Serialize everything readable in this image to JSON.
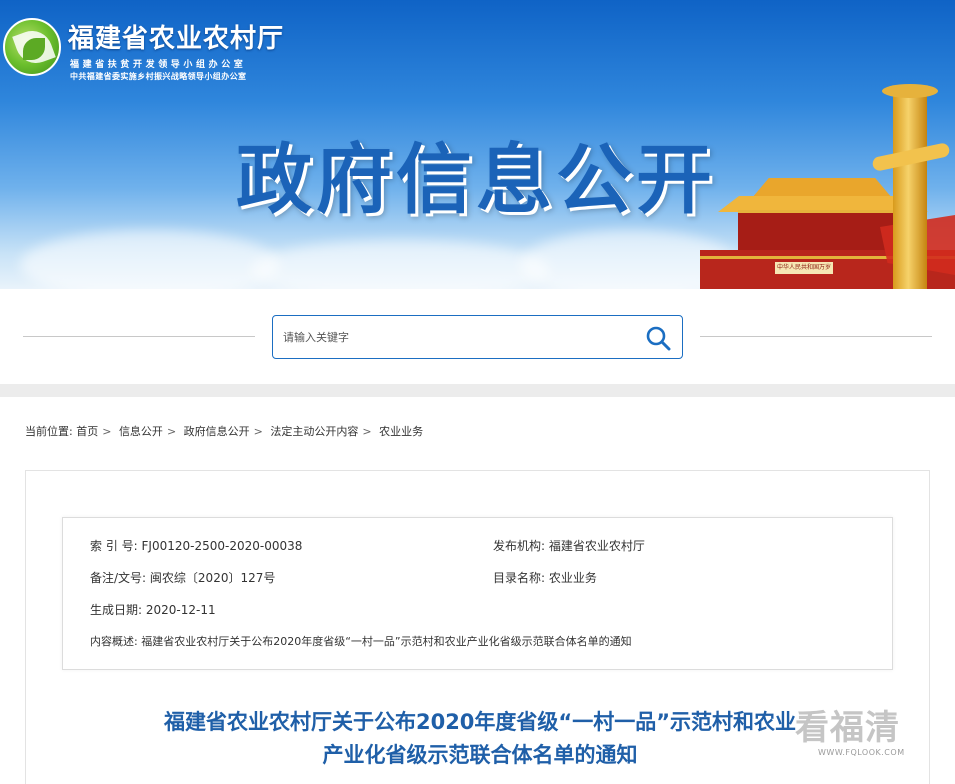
{
  "header": {
    "org_name": "福建省农业农村厅",
    "org_sub1": "福建省扶贫开发领导小组办公室",
    "org_sub2": "中共福建省委实施乡村振兴战略领导小组办公室",
    "banner_title": "政府信息公开",
    "gate_plaque": "中华人民共和国万岁"
  },
  "search": {
    "placeholder": "请输入关键字"
  },
  "breadcrumb": {
    "prefix": "当前位置:",
    "items": [
      "首页",
      "信息公开",
      "政府信息公开",
      "法定主动公开内容",
      "农业业务"
    ],
    "separator": ">"
  },
  "meta": {
    "index_label": "索 引 号:",
    "index_value": "FJ00120-2500-2020-00038",
    "publisher_label": "发布机构:",
    "publisher_value": "福建省农业农村厅",
    "docno_label": "备注/文号:",
    "docno_value": "闽农综〔2020〕127号",
    "category_label": "目录名称:",
    "category_value": "农业业务",
    "date_label": "生成日期:",
    "date_value": "2020-12-11",
    "summary_label": "内容概述:",
    "summary_value": "福建省农业农村厅关于公布2020年度省级“一村一品”示范村和农业产业化省级示范联合体名单的通知"
  },
  "document": {
    "title_line1": "福建省农业农村厅关于公布2020年度省级“一村一品”示范村和农业",
    "title_line2": "产业化省级示范联合体名单的通知"
  },
  "watermark": {
    "text": "看福清",
    "url": "WWW.FQLOOK.COM"
  },
  "colors": {
    "brand_blue": "#1b6ec2",
    "title_blue": "#1f5fa8"
  }
}
